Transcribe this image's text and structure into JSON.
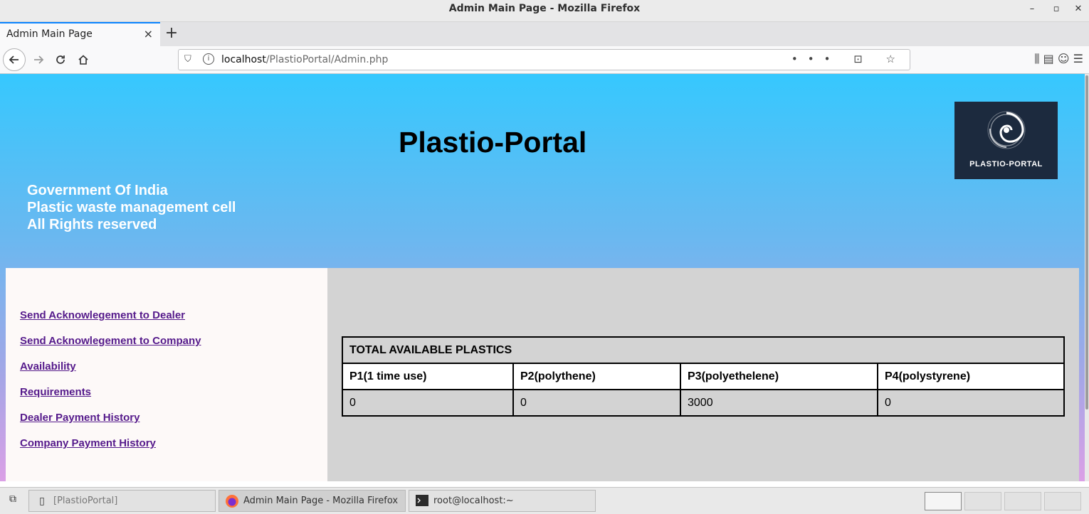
{
  "window": {
    "title": "Admin Main Page - Mozilla Firefox",
    "minimize": "–",
    "maximize": "▫",
    "close": "✕"
  },
  "browser": {
    "tab_title": "Admin Main Page",
    "tab_close": "×",
    "new_tab": "+",
    "url_host": "localhost",
    "url_path": "/PlastioPortal/Admin.php",
    "page_actions": "••• ⊡ ☆",
    "toolbar_icons": "⫼  ▤  ☺  ☰"
  },
  "page": {
    "site_title": "Plastio-Portal",
    "gov_lines": [
      "Government Of India",
      "Plastic waste management cell",
      "All Rights reserved"
    ],
    "logo_text": "PLASTIO-PORTAL"
  },
  "sidebar": {
    "links": [
      "Send Acknowlegement to Dealer",
      "Send Acknowlegement to Company",
      "Availability",
      "Requirements",
      "Dealer Payment History",
      "Company Payment History"
    ]
  },
  "table": {
    "caption": "TOTAL AVAILABLE PLASTICS",
    "headers": [
      "P1(1 time use)",
      "P2(polythene)",
      "P3(polyethelene)",
      "P4(polystyrene)"
    ],
    "values": [
      "0",
      "0",
      "3000",
      "0"
    ]
  },
  "taskbar": {
    "tasks": [
      "[PlastioPortal]",
      "Admin Main Page - Mozilla Firefox",
      "root@localhost:~"
    ]
  }
}
